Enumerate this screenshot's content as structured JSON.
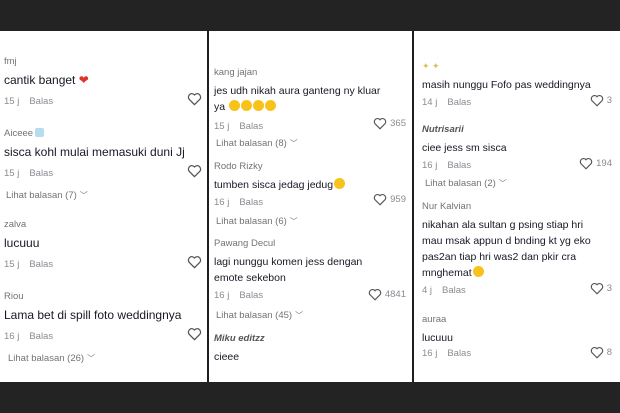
{
  "col1": {
    "comments": [
      {
        "user": "fmj",
        "text": "cantik banget",
        "emoji": "❤",
        "time": "15 j",
        "reply": "Balas"
      },
      {
        "user": "Aiceee",
        "text": "sisca kohl mulai memasuki duni Jj",
        "time": "15 j",
        "reply": "Balas",
        "view": "Lihat balasan (7)"
      },
      {
        "user": "zalva",
        "text": "lucuuu",
        "time": "15 j",
        "reply": "Balas"
      },
      {
        "user": "Riou",
        "text": "Lama bet di spill foto weddingnya",
        "time": "16 j",
        "reply": "Balas",
        "view": "Lihat balasan (26)"
      }
    ]
  },
  "col2": {
    "comments": [
      {
        "user": "kang jajan",
        "text1": "jes udh nikah aura ganteng ny kluar",
        "text2": "ya",
        "time": "15 j",
        "reply": "Balas",
        "likes": "365",
        "view": "Lihat balasan (8)"
      },
      {
        "user": "Rodo Rizky",
        "text": "tumben sisca jedag jedug",
        "time": "16 j",
        "reply": "Balas",
        "likes": "959",
        "view": "Lihat balasan (6)"
      },
      {
        "user": "Pawang Decul",
        "text1": "lagi nunggu komen jess dengan",
        "text2": "emote sekebon",
        "time": "16 j",
        "reply": "Balas",
        "likes": "4841",
        "view": "Lihat balasan (45)"
      },
      {
        "user": "Miku editzz",
        "text": "cieee"
      }
    ]
  },
  "col3": {
    "comments": [
      {
        "user": "",
        "text": "masih nunggu Fofo pas weddingnya",
        "time": "14 j",
        "reply": "Balas",
        "likes": "3"
      },
      {
        "user": "Nutrisarii",
        "text": "ciee jess sm sisca",
        "time": "16 j",
        "reply": "Balas",
        "likes": "194",
        "view": "Lihat balasan (2)"
      },
      {
        "user": "Nur Kalvian",
        "text1": "nikahan ala sultan g psing stiap hri",
        "text2": "mau msak appun d bnding kt yg eko",
        "text3": "pas2an tiap hri was2 dan pkir cra",
        "text4": "mnghemat",
        "time": "4 j",
        "reply": "Balas",
        "likes": "3"
      },
      {
        "user": "auraa",
        "text": "lucuuu",
        "time": "16 j",
        "reply": "Balas",
        "likes": "8"
      }
    ]
  },
  "colors": {
    "heart": "#e0312a",
    "muted": "#8a8b91",
    "text": "#161823"
  }
}
